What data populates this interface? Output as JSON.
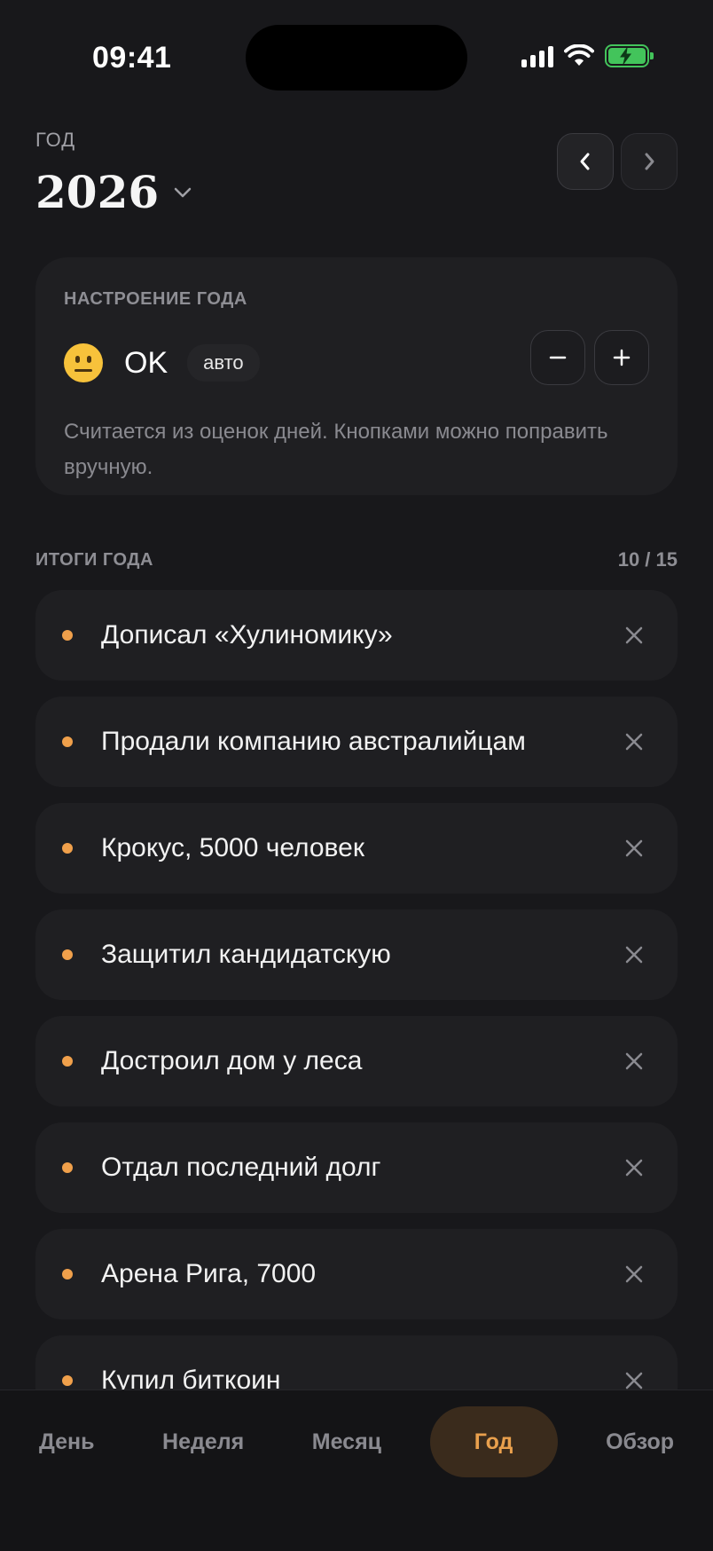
{
  "status_bar": {
    "time": "09:41"
  },
  "header": {
    "caption": "ГОД",
    "year": "2026"
  },
  "mood": {
    "caption": "НАСТРОЕНИЕ ГОДА",
    "label": "OK",
    "badge": "авто",
    "hint": "Считается из оценок дней. Кнопками можно поправить вручную."
  },
  "results": {
    "title": "ИТОГИ ГОДА",
    "count": "10 / 15",
    "items": [
      "Дописал «Хулиномику»",
      "Продали компанию австралийцам",
      "Крокус, 5000 человек",
      "Защитил кандидатскую",
      "Достроил дом у леса",
      "Отдал последний долг",
      "Арена Рига, 7000",
      "Купил биткоин"
    ]
  },
  "tabs": [
    {
      "label": "День"
    },
    {
      "label": "Неделя"
    },
    {
      "label": "Месяц"
    },
    {
      "label": "Год",
      "active": true
    },
    {
      "label": "Обзор"
    }
  ],
  "colors": {
    "accent": "#e9a04d",
    "bullet": "#f0a04b",
    "background": "#18181b",
    "card": "#1f1f22",
    "battery": "#43c45b"
  }
}
